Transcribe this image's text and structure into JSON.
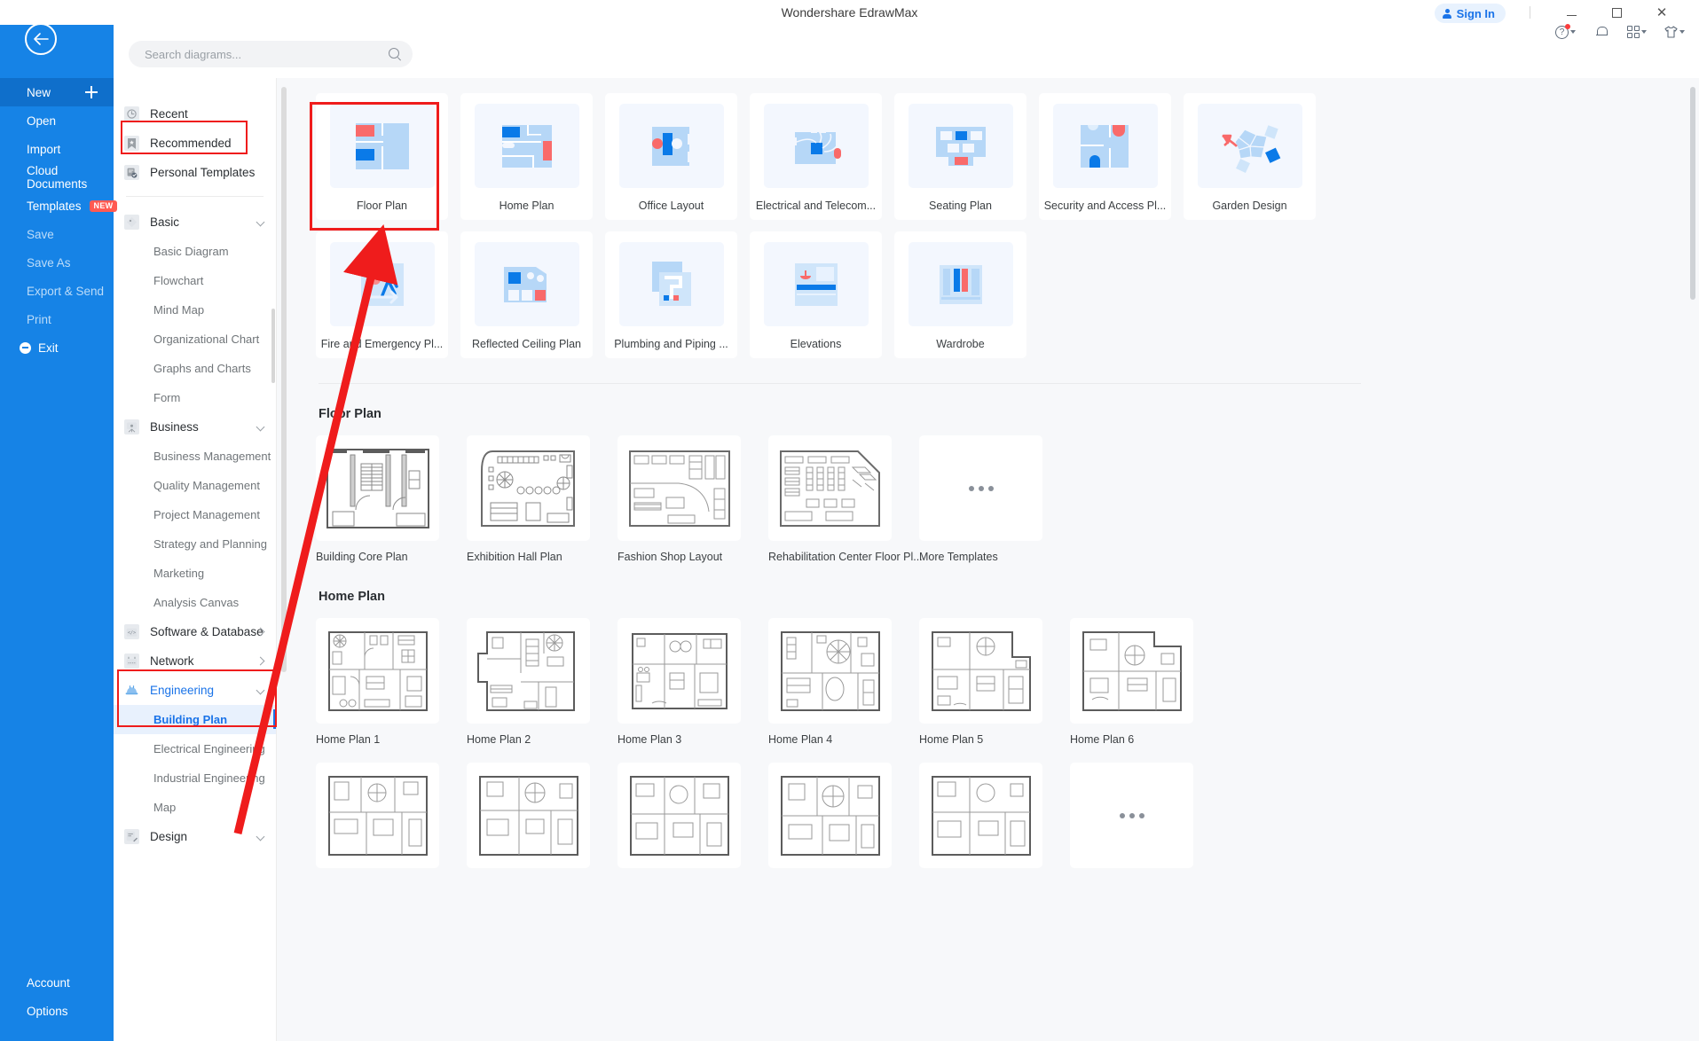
{
  "window": {
    "title": "Wondershare EdrawMax",
    "sign_in": "Sign In",
    "minimize_icon": "minimize-icon",
    "maximize_icon": "maximize-icon",
    "close_icon": "close-icon"
  },
  "toolbar": {
    "help_icon": "help-circle-icon",
    "notification_icon": "bell-icon",
    "apps_icon": "apps-grid-icon",
    "theme_icon": "theme-shirt-icon"
  },
  "rail": {
    "back_icon": "back-arrow-icon",
    "items": [
      {
        "label": "New",
        "state": "active",
        "trailing_icon": "plus-icon"
      },
      {
        "label": "Open",
        "state": "normal"
      },
      {
        "label": "Import",
        "state": "normal"
      },
      {
        "label": "Cloud Documents",
        "state": "normal"
      },
      {
        "label": "Templates",
        "state": "normal",
        "badge": "NEW"
      },
      {
        "label": "Save",
        "state": "dim"
      },
      {
        "label": "Save As",
        "state": "dim"
      },
      {
        "label": "Export & Send",
        "state": "dim"
      },
      {
        "label": "Print",
        "state": "dim"
      },
      {
        "label": "Exit",
        "state": "normal",
        "leading_icon": "exit-icon"
      }
    ],
    "bottom_items": [
      {
        "label": "Account"
      },
      {
        "label": "Options"
      }
    ]
  },
  "search": {
    "placeholder": "Search diagrams...",
    "value": "",
    "icon": "search-icon"
  },
  "tree": {
    "quick": [
      {
        "label": "Recent",
        "icon": "clock-icon"
      },
      {
        "label": "Recommended",
        "icon": "star-bookmark-icon",
        "highlighted": true
      },
      {
        "label": "Personal Templates",
        "icon": "personal-templates-icon"
      }
    ],
    "groups": [
      {
        "label": "Basic",
        "icon": "tag-icon",
        "expanded": true,
        "children": [
          "Basic Diagram",
          "Flowchart",
          "Mind Map",
          "Organizational Chart",
          "Graphs and Charts",
          "Form"
        ]
      },
      {
        "label": "Business",
        "icon": "presentation-icon",
        "expanded": true,
        "children": [
          "Business Management",
          "Quality Management",
          "Project Management",
          "Strategy and Planning",
          "Marketing",
          "Analysis Canvas"
        ]
      },
      {
        "label": "Software & Database",
        "icon": "code-icon",
        "expanded": false,
        "children": []
      },
      {
        "label": "Network",
        "icon": "network-icon",
        "expanded": false,
        "children": []
      },
      {
        "label": "Engineering",
        "icon": "hardhat-icon",
        "expanded": true,
        "selected": true,
        "children": [
          "Building Plan",
          "Electrical Engineering",
          "Industrial Engineering",
          "Map"
        ],
        "selected_child": "Building Plan"
      },
      {
        "label": "Design",
        "icon": "design-icon",
        "expanded": true,
        "children": []
      }
    ]
  },
  "main": {
    "categories_row1": [
      {
        "label": "Floor Plan",
        "thumb": "floor-plan-thumb",
        "highlighted": true
      },
      {
        "label": "Home Plan",
        "thumb": "home-plan-thumb"
      },
      {
        "label": "Office Layout",
        "thumb": "office-layout-thumb"
      },
      {
        "label": "Electrical and Telecom...",
        "thumb": "electrical-telecom-thumb"
      },
      {
        "label": "Seating Plan",
        "thumb": "seating-plan-thumb"
      },
      {
        "label": "Security and Access Pl...",
        "thumb": "security-access-thumb"
      },
      {
        "label": "Garden Design",
        "thumb": "garden-design-thumb"
      }
    ],
    "categories_row2": [
      {
        "label": "Fire and Emergency Pl...",
        "thumb": "fire-emergency-thumb"
      },
      {
        "label": "Reflected Ceiling Plan",
        "thumb": "reflected-ceiling-thumb"
      },
      {
        "label": "Plumbing and Piping ...",
        "thumb": "plumbing-piping-thumb"
      },
      {
        "label": "Elevations",
        "thumb": "elevations-thumb"
      },
      {
        "label": "Wardrobe",
        "thumb": "wardrobe-thumb"
      }
    ],
    "sections": [
      {
        "title": "Floor Plan",
        "templates": [
          {
            "label": "Building Core Plan",
            "thumb": "building-core-plan"
          },
          {
            "label": "Exhibition Hall Plan",
            "thumb": "exhibition-hall-plan"
          },
          {
            "label": "Fashion Shop Layout",
            "thumb": "fashion-shop-layout"
          },
          {
            "label": "Rehabilitation Center Floor Pl...",
            "thumb": "rehabilitation-center"
          },
          {
            "label": "More Templates",
            "thumb": "more-templates-dots"
          }
        ]
      },
      {
        "title": "Home Plan",
        "templates": [
          {
            "label": "Home Plan 1",
            "thumb": "home-plan-1"
          },
          {
            "label": "Home Plan 2",
            "thumb": "home-plan-2"
          },
          {
            "label": "Home Plan 3",
            "thumb": "home-plan-3"
          },
          {
            "label": "Home Plan 4",
            "thumb": "home-plan-4"
          },
          {
            "label": "Home Plan 5",
            "thumb": "home-plan-5"
          },
          {
            "label": "Home Plan 6",
            "thumb": "home-plan-6"
          }
        ],
        "templates_row2": [
          {
            "label": "",
            "thumb": "home-plan-7"
          },
          {
            "label": "",
            "thumb": "home-plan-8"
          },
          {
            "label": "",
            "thumb": "home-plan-9"
          },
          {
            "label": "",
            "thumb": "home-plan-10"
          },
          {
            "label": "",
            "thumb": "home-plan-11"
          },
          {
            "label": "",
            "thumb": "more-templates-dots"
          }
        ]
      }
    ]
  },
  "annotations": {
    "accent_color": "#ef1c1c",
    "boxes": [
      "recommended-tree-item",
      "floor-plan-category-card",
      "engineering-building-plan"
    ],
    "arrow": "red-arrow-from-building-plan-to-floor-plan"
  },
  "colors": {
    "rail_blue": "#1683e6",
    "rail_active": "#0f6fcb",
    "accent_blue": "#1a73e8",
    "main_bg": "#f7f8fa",
    "thumb_bg": "#f3f7fe",
    "badge_red": "#ff5a52"
  }
}
